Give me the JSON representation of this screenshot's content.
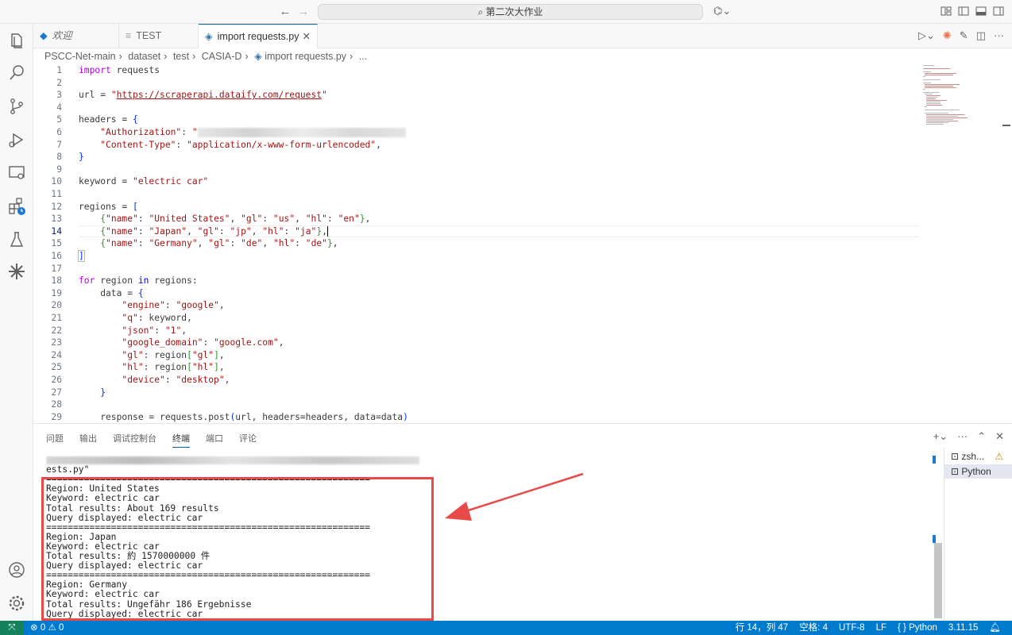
{
  "window": {
    "search_text": "第二次大作业",
    "back_icon": "←",
    "forward_icon": "→"
  },
  "tabs": [
    {
      "label": "欢迎"
    },
    {
      "label": "TEST"
    },
    {
      "label": "import requests.py"
    }
  ],
  "breadcrumb": [
    "PSCC-Net-main",
    "dataset",
    "test",
    "CASIA-D",
    "import requests.py",
    "..."
  ],
  "editor": {
    "current_line": 14,
    "lines": [
      {
        "n": "1"
      },
      {
        "n": "2"
      },
      {
        "n": "3"
      },
      {
        "n": "4"
      },
      {
        "n": "5"
      },
      {
        "n": "6"
      },
      {
        "n": "7"
      },
      {
        "n": "8"
      },
      {
        "n": "9"
      },
      {
        "n": "10"
      },
      {
        "n": "11"
      },
      {
        "n": "12"
      },
      {
        "n": "13"
      },
      {
        "n": "14"
      },
      {
        "n": "15"
      },
      {
        "n": "16"
      },
      {
        "n": "17"
      },
      {
        "n": "18"
      },
      {
        "n": "19"
      },
      {
        "n": "20"
      },
      {
        "n": "21"
      },
      {
        "n": "22"
      },
      {
        "n": "23"
      },
      {
        "n": "24"
      },
      {
        "n": "25"
      },
      {
        "n": "26"
      },
      {
        "n": "27"
      },
      {
        "n": "28"
      },
      {
        "n": "29"
      }
    ]
  },
  "panel": {
    "tabs": [
      "问题",
      "输出",
      "调试控制台",
      "终端",
      "端口",
      "评论"
    ],
    "active_tab": "终端",
    "terminal_list": [
      "zsh...",
      "Python"
    ],
    "terminal_lines": [
      "ests.py\"",
      "============================================================",
      "Region: United States",
      "Keyword: electric car",
      "Total results: About 169 results",
      "Query displayed: electric car",
      "============================================================",
      "Region: Japan",
      "Keyword: electric car",
      "Total results: 約 1570000000 件",
      "Query displayed: electric car",
      "============================================================",
      "Region: Germany",
      "Keyword: electric car",
      "Total results: Ungefähr 186 Ergebnisse",
      "Query displayed: electric car"
    ]
  },
  "statusbar": {
    "errors": "0",
    "warnings": "0",
    "position": "行 14，列 47",
    "spaces": "空格: 4",
    "encoding": "UTF-8",
    "eol": "LF",
    "language": "{ } Python",
    "interpreter": "3.11.15"
  },
  "colors": {
    "accent": "#007acc",
    "annotation": "#e84a4a"
  }
}
